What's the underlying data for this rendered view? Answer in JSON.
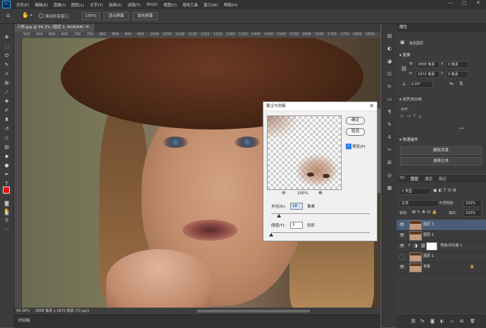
{
  "app": {
    "logo": "Ps"
  },
  "menu": [
    "文件(F)",
    "编辑(E)",
    "图像(I)",
    "图层(L)",
    "文字(Y)",
    "选择(S)",
    "滤镜(T)",
    "3D(D)",
    "视图(V)",
    "增效工具",
    "窗口(W)",
    "帮助(H)"
  ],
  "window_controls": {
    "minimize": "—",
    "maximize": "□",
    "close": "✕"
  },
  "options_bar": {
    "scroll_all_label": "滚动所有窗口",
    "zoom_value": "100%",
    "fit_screen": "适合屏幕",
    "fill_screen": "填充屏幕"
  },
  "document": {
    "tab_title": "人物.jpg @ 94.3% (图层 3, RGB/8#) *",
    "ruler_ticks": [
      "500",
      "550",
      "600",
      "650",
      "700",
      "750",
      "800",
      "850",
      "900",
      "950",
      "1000",
      "1050",
      "1100",
      "1150",
      "1200",
      "1250",
      "1300",
      "1350",
      "1400",
      "1450",
      "1500",
      "1550",
      "1600",
      "1650",
      "1700",
      "1750",
      "1800",
      "1850"
    ]
  },
  "status_bar": {
    "zoom": "94.28%",
    "info": "2808 像素 x 1872 像素 (72 ppi)",
    "arrow": "›"
  },
  "timeline": {
    "label": "时间轴"
  },
  "dialog": {
    "title": "蒙尘与划痕",
    "close": "✕",
    "ok": "确定",
    "cancel": "取消",
    "preview_label": "预览(P)",
    "preview_checked": true,
    "zoom_level": "100%",
    "radius_label": "半径(R):",
    "radius_value": "18",
    "radius_unit": "像素",
    "threshold_label": "阈值(T):",
    "threshold_value": "3",
    "threshold_unit": "色阶"
  },
  "properties": {
    "tab": "属性",
    "subhead": "像素图层",
    "transform_label": "变换",
    "w_label": "W",
    "w_value": "2808 像素",
    "h_label": "H",
    "h_value": "1872 像素",
    "x_label": "X",
    "x_value": "0 像素",
    "y_label": "Y",
    "y_value": "0 像素",
    "angle_value": "0.00°",
    "align_label": "对齐并分布",
    "align_sub": "对齐:",
    "more": "•••",
    "quick_label": "快速操作",
    "remove_bg": "删除背景",
    "select_subject": "选择主体"
  },
  "layers_panel": {
    "tabs": [
      "3D",
      "图层",
      "通道",
      "路径"
    ],
    "filter_kind": "类型",
    "blend_mode": "正常",
    "opacity_label": "不透明度:",
    "opacity_value": "100%",
    "lock_label": "锁定:",
    "fill_label": "填充:",
    "fill_value": "100%",
    "layers": [
      {
        "name": "图层 3",
        "selected": true
      },
      {
        "name": "图层 2",
        "selected": false
      },
      {
        "name": "亮度/对比度 1",
        "selected": false
      },
      {
        "name": "图层 1",
        "selected": false
      },
      {
        "name": "背景",
        "selected": false
      }
    ],
    "footer_icons": [
      "link-icon",
      "fx-icon",
      "mask-icon",
      "adjust-icon",
      "group-icon",
      "new-layer-icon",
      "trash-icon"
    ]
  }
}
